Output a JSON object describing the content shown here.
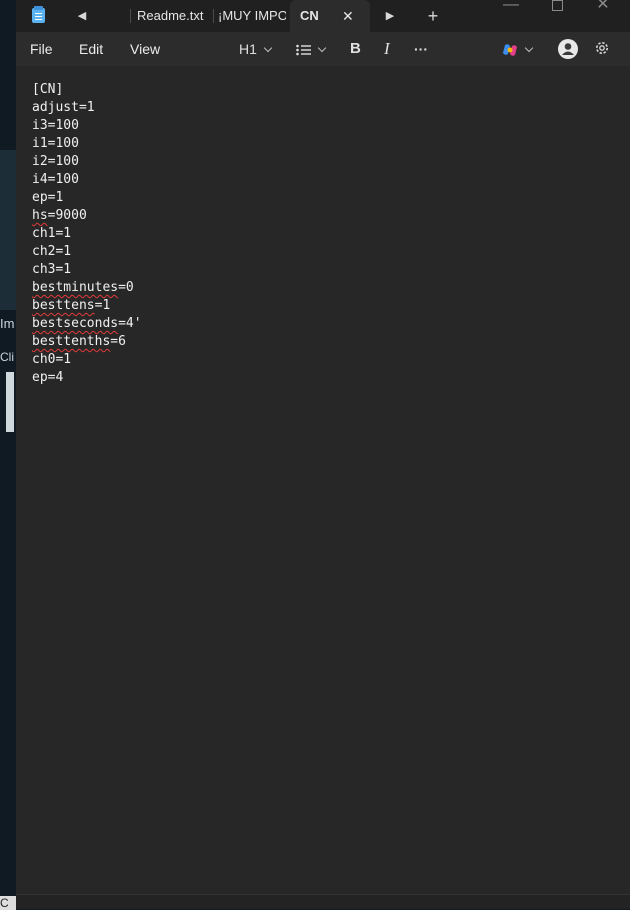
{
  "background": {
    "partial_text_1": "Im",
    "partial_text_2": "Cli",
    "partial_text_3": "C"
  },
  "titlebar": {
    "tabs": [
      {
        "label": "Readme.txt"
      },
      {
        "label": "¡MUY IMPOR"
      },
      {
        "label": "CN",
        "active": true
      }
    ],
    "close_tab": "✕",
    "new_tab": "+"
  },
  "menubar": {
    "file": "File",
    "edit": "Edit",
    "view": "View",
    "heading": "H1",
    "bold": "B",
    "italic": "I",
    "more": "···"
  },
  "document": {
    "lines": [
      {
        "text": "[CN]"
      },
      {
        "text": "adjust=1"
      },
      {
        "text": "i3=100"
      },
      {
        "text": "i1=100"
      },
      {
        "text": "i2=100"
      },
      {
        "text": "i4=100"
      },
      {
        "text": "ep=1"
      },
      {
        "text": "hs=9000",
        "misspelled": "hs"
      },
      {
        "text": "ch1=1"
      },
      {
        "text": "ch2=1"
      },
      {
        "text": "ch3=1"
      },
      {
        "text": "bestminutes=0",
        "misspelled": "bestminutes"
      },
      {
        "text": "besttens=1",
        "misspelled": "besttens"
      },
      {
        "text": "bestseconds=4'",
        "misspelled": "bestseconds"
      },
      {
        "text": "besttenths=6",
        "misspelled": "besttenths"
      },
      {
        "text": "ch0=1"
      },
      {
        "text": "ep=4"
      }
    ]
  },
  "colors": {
    "accent": "#5bb2f1",
    "spellcheck": "#e03a3a",
    "editor_bg": "#272727"
  }
}
